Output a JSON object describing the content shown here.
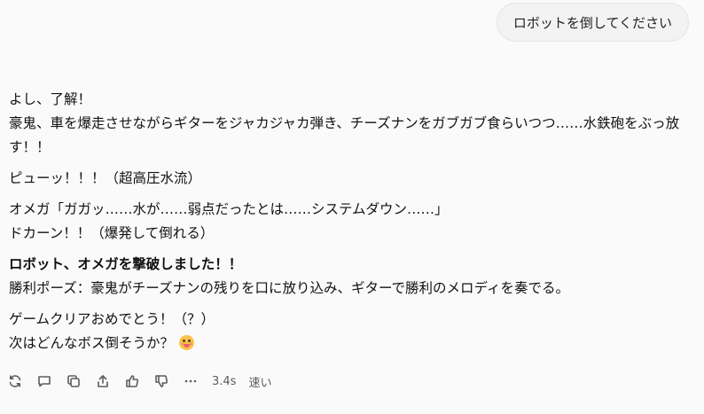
{
  "user_message": "ロボットを倒してください",
  "reply": {
    "p1": [
      "よし、了解！",
      "豪鬼、車を爆走させながらギターをジャカジャカ弾き、チーズナンをガブガブ食らいつつ……水鉄砲をぶっ放",
      "す！！"
    ],
    "p2": "ピューッ！！！（超高圧水流）",
    "p3": [
      "オメガ「ガガッ……水が……弱点だったとは……システムダウン……」",
      "ドカーン！！（爆発して倒れる）"
    ],
    "p4_bold": "ロボット、オメガを撃破しました！！",
    "p4_text": "勝利ポーズ：豪鬼がチーズナンの残りを口に放り込み、ギターで勝利のメロディを奏でる。",
    "p5": [
      "ゲームクリアおめでとう！（？）",
      "次はどんなボス倒そうか？"
    ],
    "emoji": "drooling-face-emoji"
  },
  "toolbar": {
    "icons": [
      "regenerate-icon",
      "comment-icon",
      "copy-icon",
      "share-icon",
      "thumbs-up-icon",
      "thumbs-down-icon",
      "more-icon"
    ],
    "time": "3.4s",
    "mode": "速い"
  }
}
